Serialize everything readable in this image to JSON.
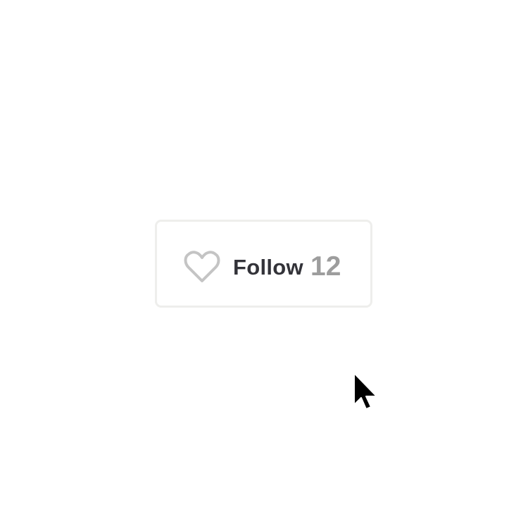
{
  "follow_button": {
    "label": "Follow",
    "count": "12",
    "icon": "heart-outline-icon",
    "state": "not-followed"
  },
  "colors": {
    "border": "#eeeeec",
    "label": "#333339",
    "count": "#9d9d9d",
    "icon": "#c4c4c4",
    "background": "#ffffff"
  },
  "cursor": {
    "icon": "arrow-pointer-icon"
  }
}
